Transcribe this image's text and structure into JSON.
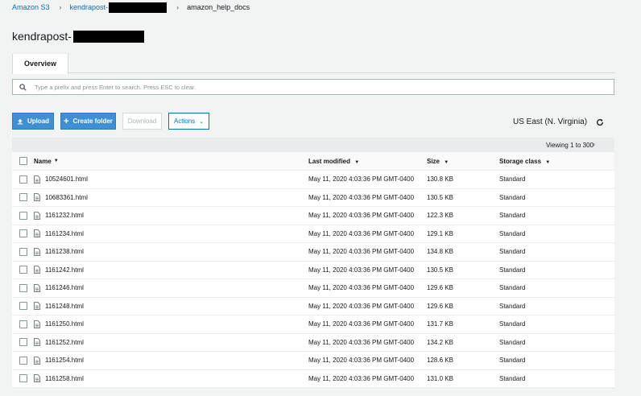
{
  "breadcrumb": {
    "root": "Amazon S3",
    "bucket": "kendrapost-",
    "folder": "amazon_help_docs"
  },
  "page_title": "kendrapost-",
  "tabs": [
    {
      "label": "Overview"
    }
  ],
  "search": {
    "placeholder": "Type a prefix and press Enter to search. Press ESC to clear.",
    "value": ""
  },
  "toolbar": {
    "upload_label": "Upload",
    "create_folder_label": "Create folder",
    "download_label": "Download",
    "actions_label": "Actions",
    "region": "US East (N. Virginia)"
  },
  "pagination": {
    "viewing": "Viewing 1 to 300"
  },
  "table": {
    "columns": {
      "name": "Name",
      "last_modified": "Last modified",
      "size": "Size",
      "storage_class": "Storage class"
    },
    "rows": [
      {
        "name": "10524601.html",
        "last_modified": "May 11, 2020 4:03:36 PM GMT-0400",
        "size": "130.8 KB",
        "storage_class": "Standard"
      },
      {
        "name": "10683361.html",
        "last_modified": "May 11, 2020 4:03:36 PM GMT-0400",
        "size": "130.5 KB",
        "storage_class": "Standard"
      },
      {
        "name": "1161232.html",
        "last_modified": "May 11, 2020 4:03:36 PM GMT-0400",
        "size": "122.3 KB",
        "storage_class": "Standard"
      },
      {
        "name": "1161234.html",
        "last_modified": "May 11, 2020 4:03:36 PM GMT-0400",
        "size": "129.1 KB",
        "storage_class": "Standard"
      },
      {
        "name": "1161238.html",
        "last_modified": "May 11, 2020 4:03:36 PM GMT-0400",
        "size": "134.8 KB",
        "storage_class": "Standard"
      },
      {
        "name": "1161242.html",
        "last_modified": "May 11, 2020 4:03:36 PM GMT-0400",
        "size": "130.5 KB",
        "storage_class": "Standard"
      },
      {
        "name": "1161246.html",
        "last_modified": "May 11, 2020 4:03:36 PM GMT-0400",
        "size": "129.6 KB",
        "storage_class": "Standard"
      },
      {
        "name": "1161248.html",
        "last_modified": "May 11, 2020 4:03:36 PM GMT-0400",
        "size": "129.6 KB",
        "storage_class": "Standard"
      },
      {
        "name": "1161250.html",
        "last_modified": "May 11, 2020 4:03:36 PM GMT-0400",
        "size": "131.7 KB",
        "storage_class": "Standard"
      },
      {
        "name": "1161252.html",
        "last_modified": "May 11, 2020 4:03:36 PM GMT-0400",
        "size": "134.2 KB",
        "storage_class": "Standard"
      },
      {
        "name": "1161254.html",
        "last_modified": "May 11, 2020 4:03:36 PM GMT-0400",
        "size": "128.6 KB",
        "storage_class": "Standard"
      },
      {
        "name": "1161258.html",
        "last_modified": "May 11, 2020 4:03:36 PM GMT-0400",
        "size": "131.0 KB",
        "storage_class": "Standard"
      }
    ]
  },
  "colors": {
    "accent": "#3f8fd2",
    "link": "#0073bb",
    "background": "#f2f3f3"
  }
}
